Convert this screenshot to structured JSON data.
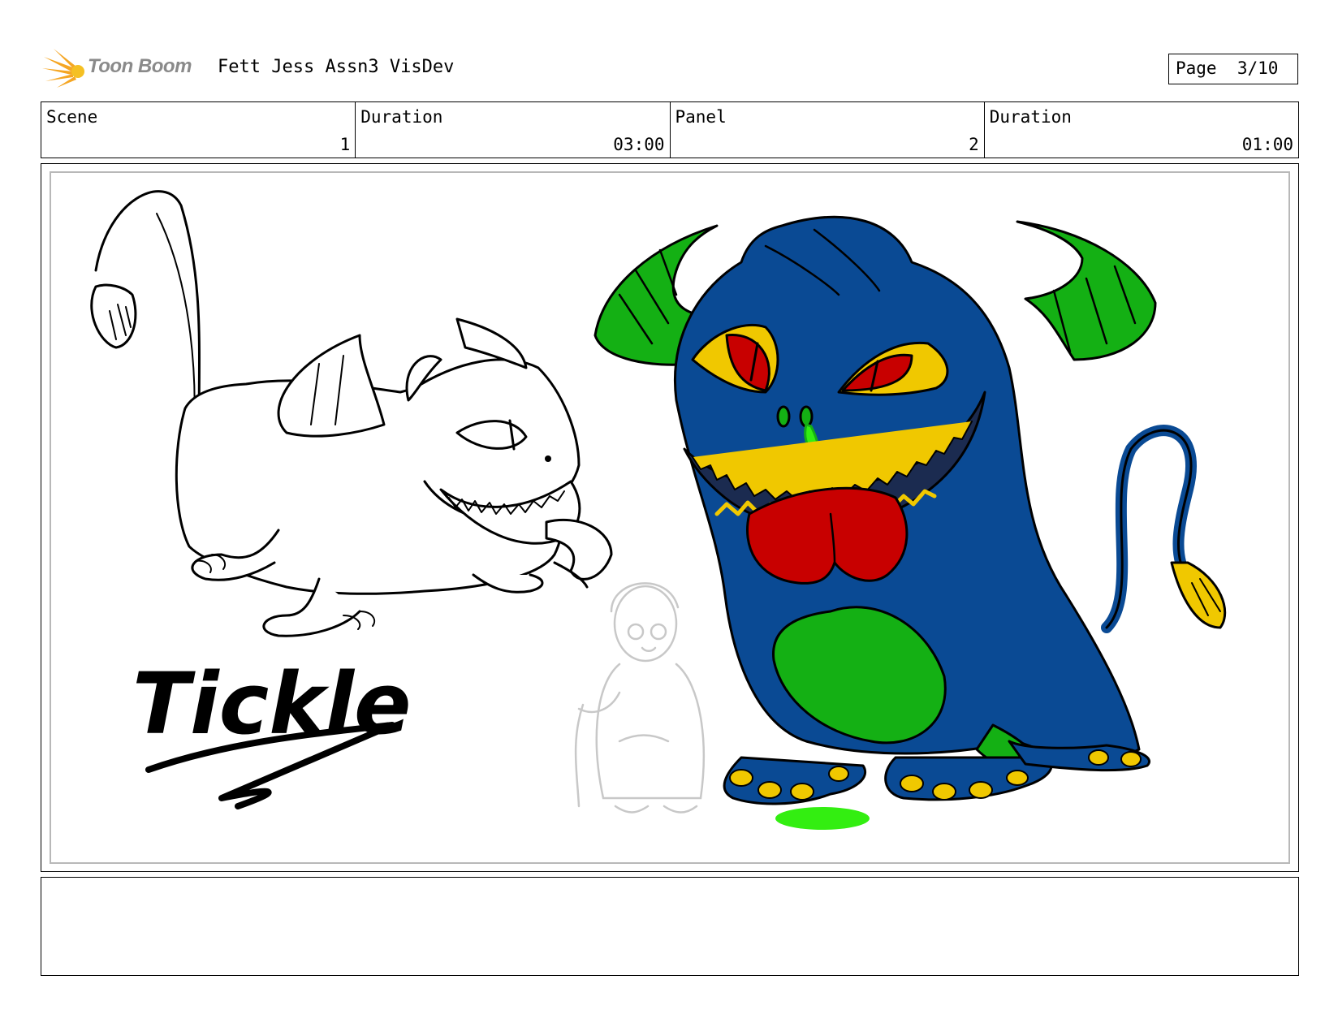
{
  "header": {
    "brand": "Toon Boom",
    "project_title": "Fett Jess Assn3 VisDev",
    "page_label": "Page",
    "page_number": "3/10"
  },
  "info": {
    "scene_label": "Scene",
    "scene_value": "1",
    "scene_duration_label": "Duration",
    "scene_duration_value": "03:00",
    "panel_label": "Panel",
    "panel_value": "2",
    "panel_duration_label": "Duration",
    "panel_duration_value": "01:00"
  },
  "panel": {
    "handwritten_title": "Tickle"
  },
  "colors": {
    "brand_orange": "#f5a623",
    "monster_blue": "#0a4a94",
    "horn_green": "#14b014",
    "eye_yellow": "#f0c800",
    "iris_red": "#c80000",
    "tongue_red": "#c80000",
    "slime_green": "#33ee11",
    "sketch_gray": "#c8c8c8"
  },
  "icons": {
    "logo": "toon-boom-starburst-icon"
  }
}
